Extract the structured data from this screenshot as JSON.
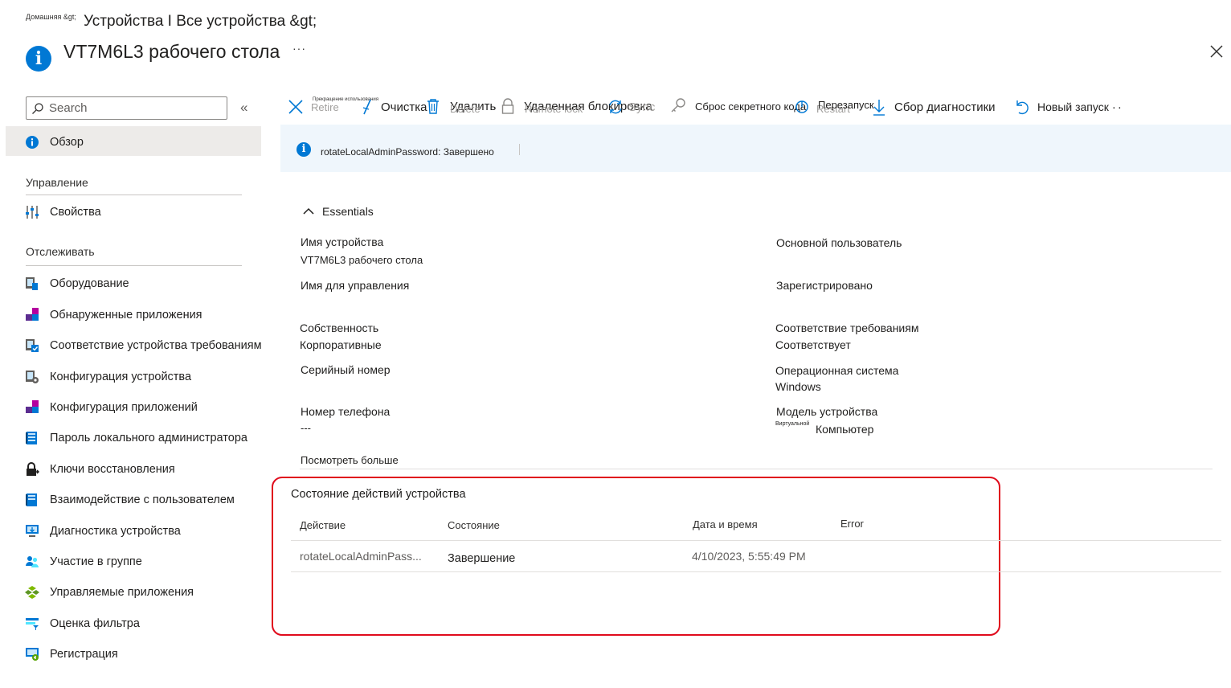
{
  "breadcrumb": {
    "home": "Домашняя &gt;",
    "path": "Устройства I Все устройства &gt;"
  },
  "header": {
    "title": "VT7M6L3 рабочего стола",
    "more": "···"
  },
  "sidebar": {
    "search_placeholder": "Search",
    "collapse_glyph": "«",
    "overview": "Обзор",
    "section_manage": "Управление",
    "properties": "Свойства",
    "section_monitor": "Отслеживать",
    "items": [
      "Оборудование",
      "Обнаруженные приложения",
      "Соответствие устройства требованиям",
      "Конфигурация устройства",
      "Конфигурация приложений",
      "Пароль локального администратора",
      "Ключи восстановления",
      "Взаимодействие с пользователем",
      "Диагностика устройства",
      "Участие в группе",
      "Управляемые приложения",
      "Оценка фильтра",
      "Регистрация"
    ]
  },
  "toolbar": {
    "retire_tiny": "Прекращение использования",
    "retire": "Retire",
    "wipe": "Очистка",
    "delete": "Удалить",
    "delete_ghost": "Delete",
    "remote_lock": "Удаленная блокировка",
    "remote_lock_ghost": "Remote lock",
    "sync": "Sync",
    "reset_passcode": "Сброс секретного кода",
    "restart": "Перезапуск",
    "restart_ghost": "Restart",
    "collect_diagnostics": "Сбор диагностики",
    "new_launch": "Новый запуск",
    "more": "··"
  },
  "banner": {
    "text": "rotateLocalAdminPassword: Завершено"
  },
  "essentials": {
    "title": "Essentials",
    "device_name_label": "Имя устройства",
    "device_name_value": "VT7M6L3 рабочего стола",
    "mgmt_name_label": "Имя для управления",
    "ownership_label": "Собственность",
    "ownership_value": "Корпоративные",
    "serial_label": "Серийный номер",
    "phone_label": "Номер телефона",
    "phone_value": "---",
    "see_more": "Посмотреть больше",
    "primary_user_label": "Основной пользователь",
    "enrolled_label": "Зарегистрировано",
    "compliance_label": "Соответствие требованиям",
    "compliance_value": "Соответствует",
    "os_label": "Операционная система",
    "os_value": "Windows",
    "model_label": "Модель устройства",
    "model_value_small": "Виртуальной",
    "model_value": "Компьютер"
  },
  "action_status": {
    "title": "Состояние действий устройства",
    "columns": [
      "Действие",
      "Состояние",
      "Дата и время",
      "Error"
    ],
    "rows": [
      {
        "action": "rotateLocalAdminPass...",
        "status": "Завершение",
        "datetime": "4/10/2023, 5:55:49 PM",
        "error": ""
      }
    ]
  },
  "colors": {
    "accent": "#0078d4",
    "highlight_box": "#e00b1c",
    "banner_bg": "#eff6fc",
    "selected_nav": "#edebe9"
  }
}
